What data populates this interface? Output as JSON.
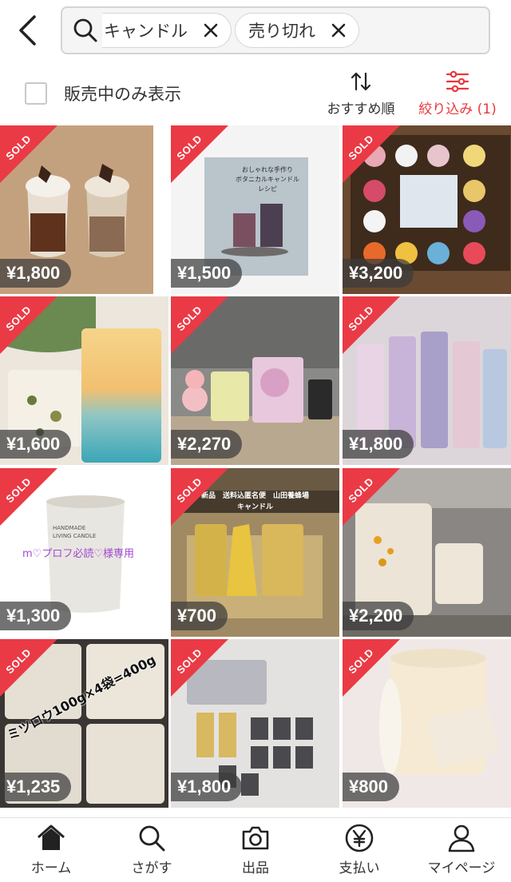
{
  "header": {
    "chips": [
      {
        "label": "キャンドル"
      },
      {
        "label": "売り切れ"
      }
    ]
  },
  "filter_bar": {
    "only_on_sale_label": "販売中のみ表示",
    "only_on_sale_checked": false,
    "sort_label": "おすすめ順",
    "filter_label": "絞り込み (1)"
  },
  "colors": {
    "accent": "#e8383d",
    "sold_ribbon": "#ea3a45"
  },
  "items": [
    {
      "sold_label": "SOLD",
      "price": "¥1,800"
    },
    {
      "sold_label": "SOLD",
      "price": "¥1,500"
    },
    {
      "sold_label": "SOLD",
      "price": "¥3,200"
    },
    {
      "sold_label": "SOLD",
      "price": "¥1,600"
    },
    {
      "sold_label": "SOLD",
      "price": "¥2,270"
    },
    {
      "sold_label": "SOLD",
      "price": "¥1,800"
    },
    {
      "sold_label": "SOLD",
      "price": "¥1,300"
    },
    {
      "sold_label": "SOLD",
      "price": "¥700"
    },
    {
      "sold_label": "SOLD",
      "price": "¥2,200"
    },
    {
      "sold_label": "SOLD",
      "price": "¥1,235"
    },
    {
      "sold_label": "SOLD",
      "price": "¥1,800"
    },
    {
      "sold_label": "SOLD",
      "price": "¥800"
    }
  ],
  "image_text": {
    "book_cover": "おしゃれな手作り\nボタニカルキャンドル\nレシピ",
    "candle_brand": "HANDMADE\nLIVING CANDLE",
    "overlay_7": "m♡プロフ必読♡様専用",
    "overlay_8": "新品　送料込匿名便　山田養蜂場\nキャンドル",
    "overlay_10": "ミツロウ100g×4袋=400g"
  },
  "tab_bar": {
    "tabs": [
      {
        "label": "ホーム",
        "icon": "home-icon"
      },
      {
        "label": "さがす",
        "icon": "search-icon"
      },
      {
        "label": "出品",
        "icon": "camera-icon"
      },
      {
        "label": "支払い",
        "icon": "yen-icon"
      },
      {
        "label": "マイページ",
        "icon": "person-icon"
      }
    ]
  }
}
